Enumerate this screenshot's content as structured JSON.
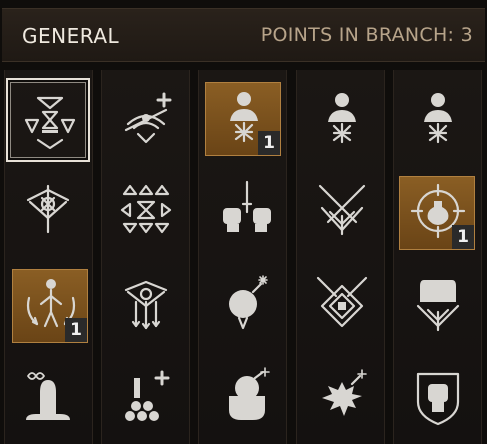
{
  "header": {
    "title": "GENERAL",
    "points": "POINTS IN BRANCH: 3"
  },
  "skills": {
    "r1c1": {
      "icon": "hourglass-triangles-icon",
      "state": "selected"
    },
    "r1c2": {
      "icon": "shield-bash-plus-icon",
      "state": "locked"
    },
    "r1c3": {
      "icon": "bust-plus-icon",
      "state": "active",
      "level": "1"
    },
    "r1c4": {
      "icon": "bust-plus-icon",
      "state": "locked"
    },
    "r1c5": {
      "icon": "bust-plus-icon",
      "state": "locked"
    },
    "r2c1": {
      "icon": "crossbow-icon",
      "state": "locked"
    },
    "r2c2": {
      "icon": "triangles-hourglass-icon",
      "state": "locked"
    },
    "r2c3": {
      "icon": "fists-dagger-icon",
      "state": "locked"
    },
    "r2c4": {
      "icon": "crossed-swords-shield-icon",
      "state": "locked"
    },
    "r2c5": {
      "icon": "potion-target-icon",
      "state": "active",
      "level": "1"
    },
    "r3c1": {
      "icon": "body-arrows-icon",
      "state": "active",
      "level": "1"
    },
    "r3c2": {
      "icon": "crossbow-bolts-icon",
      "state": "locked"
    },
    "r3c3": {
      "icon": "bomb-icon",
      "state": "locked"
    },
    "r3c4": {
      "icon": "swords-spiral-shield-icon",
      "state": "locked"
    },
    "r3c5": {
      "icon": "chest-shield-icon",
      "state": "locked"
    },
    "r4c1": {
      "icon": "infinity-stone-icon",
      "state": "locked"
    },
    "r4c2": {
      "icon": "bomb-stack-plus-icon",
      "state": "locked"
    },
    "r4c3": {
      "icon": "hand-bomb-icon",
      "state": "locked"
    },
    "r4c4": {
      "icon": "burst-bomb-icon",
      "state": "locked"
    },
    "r4c5": {
      "icon": "fist-shield-icon",
      "state": "locked"
    }
  },
  "colors": {
    "background": "#0f0d0b",
    "active_slot": "#7a5220",
    "icon": "#d8d6d2",
    "title": "#efe9df",
    "points": "#b7a48a"
  }
}
